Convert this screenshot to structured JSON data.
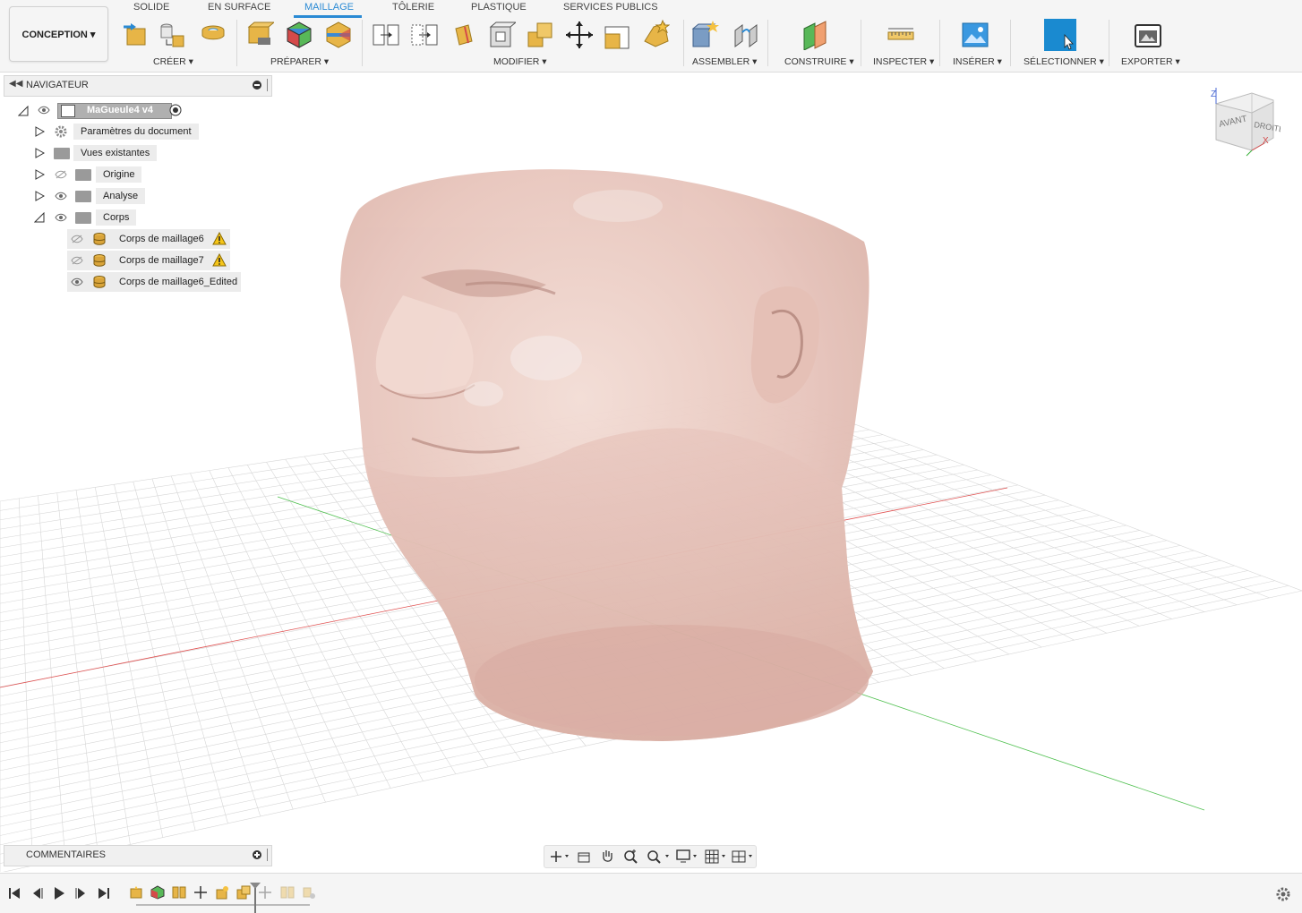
{
  "workspace": {
    "label": "CONCEPTION ▾"
  },
  "tabs": [
    {
      "label": "SOLIDE"
    },
    {
      "label": "EN SURFACE"
    },
    {
      "label": "MAILLAGE"
    },
    {
      "label": "TÔLERIE"
    },
    {
      "label": "PLASTIQUE"
    },
    {
      "label": "SERVICES PUBLICS"
    }
  ],
  "groups": {
    "creer": "CRÉER ▾",
    "preparer": "PRÉPARER ▾",
    "modifier": "MODIFIER ▾",
    "assembler": "ASSEMBLER ▾",
    "construire": "CONSTRUIRE ▾",
    "inspecter": "INSPECTER ▾",
    "inserer": "INSÉRER ▾",
    "selectionner": "SÉLECTIONNER ▾",
    "exporter": "EXPORTER ▾"
  },
  "navigator": {
    "title": "NAVIGATEUR",
    "root": "MaGueule4 v4",
    "items": [
      {
        "label": "Paramètres du document"
      },
      {
        "label": "Vues existantes"
      },
      {
        "label": "Origine"
      },
      {
        "label": "Analyse"
      },
      {
        "label": "Corps"
      }
    ],
    "bodies": [
      {
        "label": "Corps de maillage6",
        "warning": true
      },
      {
        "label": "Corps de maillage7",
        "warning": true
      },
      {
        "label": "Corps de maillage6_Edited",
        "warning": false
      }
    ]
  },
  "comments": {
    "title": "COMMENTAIRES"
  },
  "viewcube": {
    "z": "Z",
    "x": "X",
    "front": "AVANT",
    "right": "DROITE"
  },
  "colors": {
    "accent": "#2a8ad4",
    "mesh": "#e8c8c0",
    "x_axis": "#e05050",
    "y_axis": "#50c050"
  }
}
